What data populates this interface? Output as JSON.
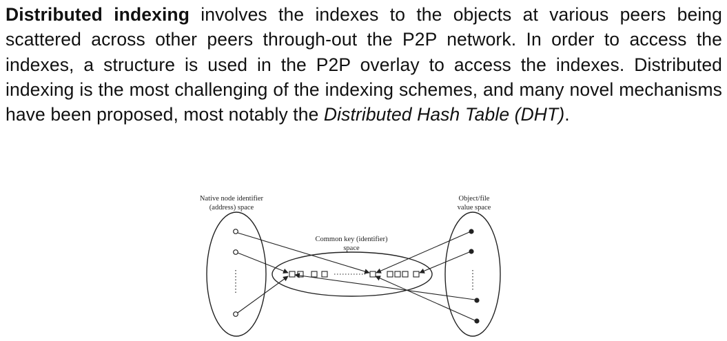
{
  "paragraph": {
    "term": "Distributed indexing",
    "text_1": " involves the indexes to the objects at various peers being scattered across other peers through-out the P2P network. In order to access the indexes, a structure is used in the P2P overlay to access the indexes. Distributed indexing is the most challenging of the indexing schemes, and many novel mechanisms have been proposed, most notably the ",
    "italic_term": "Distributed Hash Table (DHT)",
    "text_2": "."
  },
  "figure": {
    "left_label_line1": "Native node identifier",
    "left_label_line2": "(address) space",
    "right_label_line1": "Object/file",
    "right_label_line2": "value space",
    "center_label_line1": "Common key (identifier)",
    "center_label_line2": "space",
    "colors": {
      "ink": "#222222",
      "text": "#111111"
    }
  }
}
